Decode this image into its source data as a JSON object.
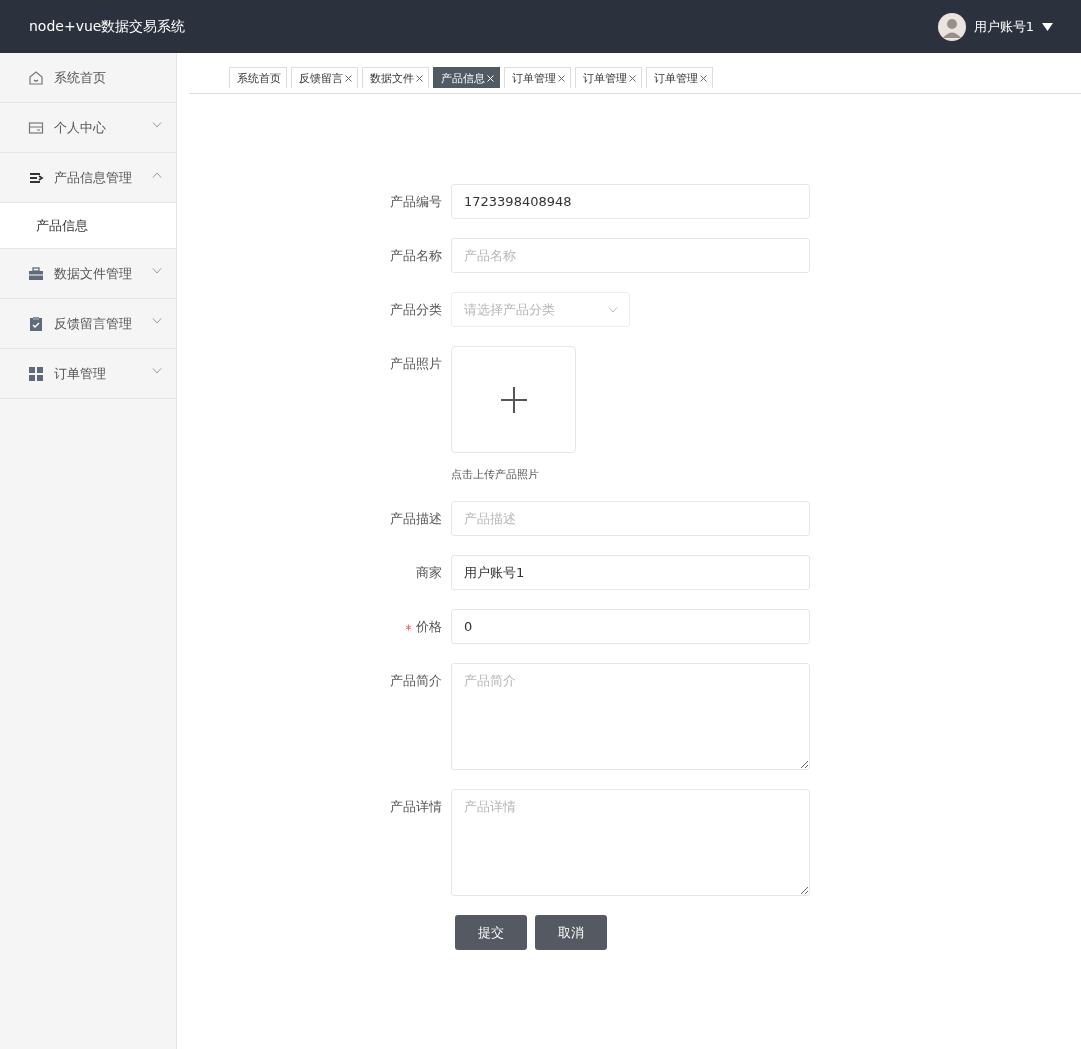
{
  "header": {
    "title": "node+vue数据交易系统",
    "user": "用户账号1"
  },
  "sidebar": {
    "items": [
      {
        "label": "系统首页"
      },
      {
        "label": "个人中心",
        "expanded": false
      },
      {
        "label": "产品信息管理",
        "expanded": true,
        "children": [
          {
            "label": "产品信息",
            "selected": true
          }
        ]
      },
      {
        "label": "数据文件管理",
        "expanded": false
      },
      {
        "label": "反馈留言管理",
        "expanded": false
      },
      {
        "label": "订单管理",
        "expanded": false
      }
    ]
  },
  "tabs": [
    {
      "label": "系统首页",
      "closable": false,
      "selected": false
    },
    {
      "label": "反馈留言",
      "closable": true,
      "selected": false
    },
    {
      "label": "数据文件",
      "closable": true,
      "selected": false
    },
    {
      "label": "产品信息",
      "closable": true,
      "selected": true
    },
    {
      "label": "订单管理",
      "closable": true,
      "selected": false
    },
    {
      "label": "订单管理",
      "closable": true,
      "selected": false
    },
    {
      "label": "订单管理",
      "closable": true,
      "selected": false
    }
  ],
  "form": {
    "fields": [
      {
        "kind": "input",
        "label": "产品编号",
        "value": "1723398408948",
        "required": false
      },
      {
        "kind": "input",
        "label": "产品名称",
        "placeholder": "产品名称",
        "required": false
      },
      {
        "kind": "select",
        "label": "产品分类",
        "placeholder": "请选择产品分类",
        "required": false
      },
      {
        "kind": "upload",
        "label": "产品照片",
        "hint": "点击上传产品照片",
        "required": false
      },
      {
        "kind": "input",
        "label": "产品描述",
        "placeholder": "产品描述",
        "required": false
      },
      {
        "kind": "input",
        "label": "商家",
        "value": "用户账号1",
        "required": false
      },
      {
        "kind": "input",
        "label": "价格",
        "value": "0",
        "required": true
      },
      {
        "kind": "textarea",
        "label": "产品简介",
        "placeholder": "产品简介",
        "required": false
      },
      {
        "kind": "textarea",
        "label": "产品详情",
        "placeholder": "产品详情",
        "required": false
      }
    ],
    "buttons": [
      "提交",
      "取消"
    ]
  }
}
